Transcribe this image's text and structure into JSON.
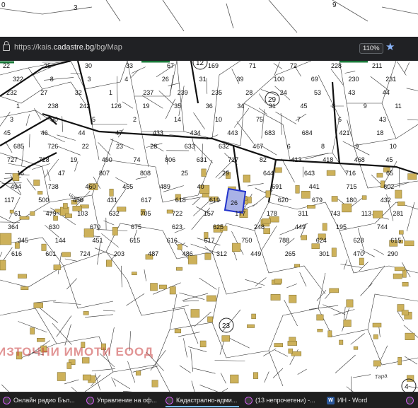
{
  "browser": {
    "url_prefix": "https://kais.",
    "url_domain": "cadastre.bg",
    "url_path": "/bg/Map",
    "zoom": "110%",
    "star_icon": "star-icon",
    "lock_icon": "lock-icon"
  },
  "top_labels": [
    "0",
    "3",
    "9"
  ],
  "map": {
    "selected_parcel": "26",
    "selected_color": "#a9b2e6",
    "building_color": "#cdb15a",
    "street_labels": [
      "Чинар",
      "Тара"
    ],
    "parcel_labels": [
      "22",
      "25",
      "30",
      "33",
      "67",
      "169",
      "71",
      "72",
      "228",
      "211",
      "322",
      "8",
      "3",
      "4",
      "26",
      "31",
      "39",
      "100",
      "69",
      "230",
      "231",
      "232",
      "27",
      "32",
      "1",
      "237",
      "239",
      "235",
      "28",
      "24",
      "53",
      "43",
      "44",
      "1",
      "238",
      "242",
      "126",
      "19",
      "35",
      "36",
      "34",
      "31",
      "45",
      "8",
      "9",
      "11",
      "3",
      "30",
      "5",
      "2",
      "14",
      "10",
      "75",
      "7",
      "6",
      "43",
      "45",
      "46",
      "44",
      "47",
      "433",
      "434",
      "443",
      "683",
      "684",
      "421",
      "18",
      "685",
      "726",
      "22",
      "23",
      "28",
      "633",
      "632",
      "467",
      "6",
      "8",
      "9",
      "10",
      "727",
      "728",
      "19",
      "490",
      "74",
      "806",
      "631",
      "717",
      "82",
      "413",
      "418",
      "468",
      "45",
      "16",
      "47",
      "807",
      "808",
      "25",
      "29",
      "644",
      "643",
      "716",
      "65",
      "494",
      "738",
      "460",
      "455",
      "489",
      "40",
      "691",
      "441",
      "715",
      "602",
      "117",
      "500",
      "456",
      "431",
      "617",
      "618",
      "619",
      "620",
      "679",
      "180",
      "432",
      "61",
      "479",
      "103",
      "632",
      "705",
      "722",
      "157",
      "177",
      "178",
      "311",
      "743",
      "113",
      "281",
      "364",
      "630",
      "670",
      "675",
      "623",
      "625",
      "248",
      "449",
      "195",
      "744",
      "345",
      "144",
      "451",
      "615",
      "616",
      "617",
      "750",
      "788",
      "624",
      "628",
      "615",
      "616",
      "601",
      "724",
      "203",
      "487",
      "486",
      "312",
      "449",
      "265",
      "301",
      "470",
      "290"
    ],
    "circled_labels": [
      "12",
      "29",
      "23",
      "4"
    ]
  },
  "watermark": "ИЗТОЧНИ ИМОТИ ЕООД",
  "taskbar": {
    "items": [
      {
        "icon": "opera-icon",
        "label": "Онлайн радио Бъл..."
      },
      {
        "icon": "opera-icon",
        "label": "Управление на оф..."
      },
      {
        "icon": "opera-icon",
        "label": "Кадастрално-адми..."
      },
      {
        "icon": "opera-icon",
        "label": "(13 непрочетени) -..."
      },
      {
        "icon": "word-icon",
        "label": "ИН - Word"
      },
      {
        "icon": "opera-icon",
        "label": ""
      }
    ]
  }
}
